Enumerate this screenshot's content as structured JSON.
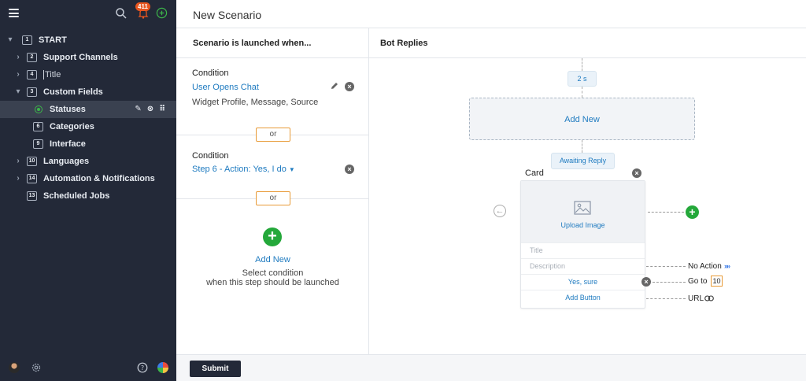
{
  "sidebar": {
    "notifications_count": "411",
    "tree": [
      {
        "num": "1",
        "label": "START",
        "arrow": "▾"
      },
      {
        "num": "2",
        "label": "Support Channels",
        "arrow": "›"
      },
      {
        "num": "4",
        "label": "Title",
        "arrow": "›"
      },
      {
        "num": "3",
        "label": "Custom Fields",
        "arrow": "▾"
      },
      {
        "label": "Statuses"
      },
      {
        "num": "6",
        "label": "Categories"
      },
      {
        "num": "9",
        "label": "Interface"
      },
      {
        "num": "10",
        "label": "Languages",
        "arrow": "›"
      },
      {
        "num": "14",
        "label": "Automation & Notifications",
        "arrow": "›"
      },
      {
        "num": "13",
        "label": "Scheduled Jobs"
      }
    ]
  },
  "header": {
    "title": "New Scenario"
  },
  "conditions": {
    "heading": "Scenario is launched when...",
    "items": [
      {
        "label": "Condition",
        "link": "User Opens Chat",
        "sub": "Widget Profile, Message, Source"
      },
      {
        "label": "Condition",
        "link": "Step 6 - Action: Yes, I do"
      }
    ],
    "or_label": "or",
    "add_new": "Add New",
    "add_note_1": "Select condition",
    "add_note_2": "when this step should be launched"
  },
  "replies": {
    "heading": "Bot Replies",
    "delay": "2 s",
    "add_new": "Add New",
    "awaiting": "Awaiting Reply",
    "card_label": "Card",
    "upload": "Upload Image",
    "title_placeholder": "Title",
    "description_placeholder": "Description",
    "button_label": "Yes, sure",
    "add_button": "Add Button",
    "no_action": "No Action",
    "goto_label": "Go to",
    "goto_value": "10",
    "url_label": "URL"
  },
  "footer": {
    "submit": "Submit"
  },
  "colors": {
    "accent": "#1f7bc0",
    "sidebar": "#232938",
    "green": "#24a83a",
    "orange": "#e89b38",
    "badge": "#e8551e"
  }
}
